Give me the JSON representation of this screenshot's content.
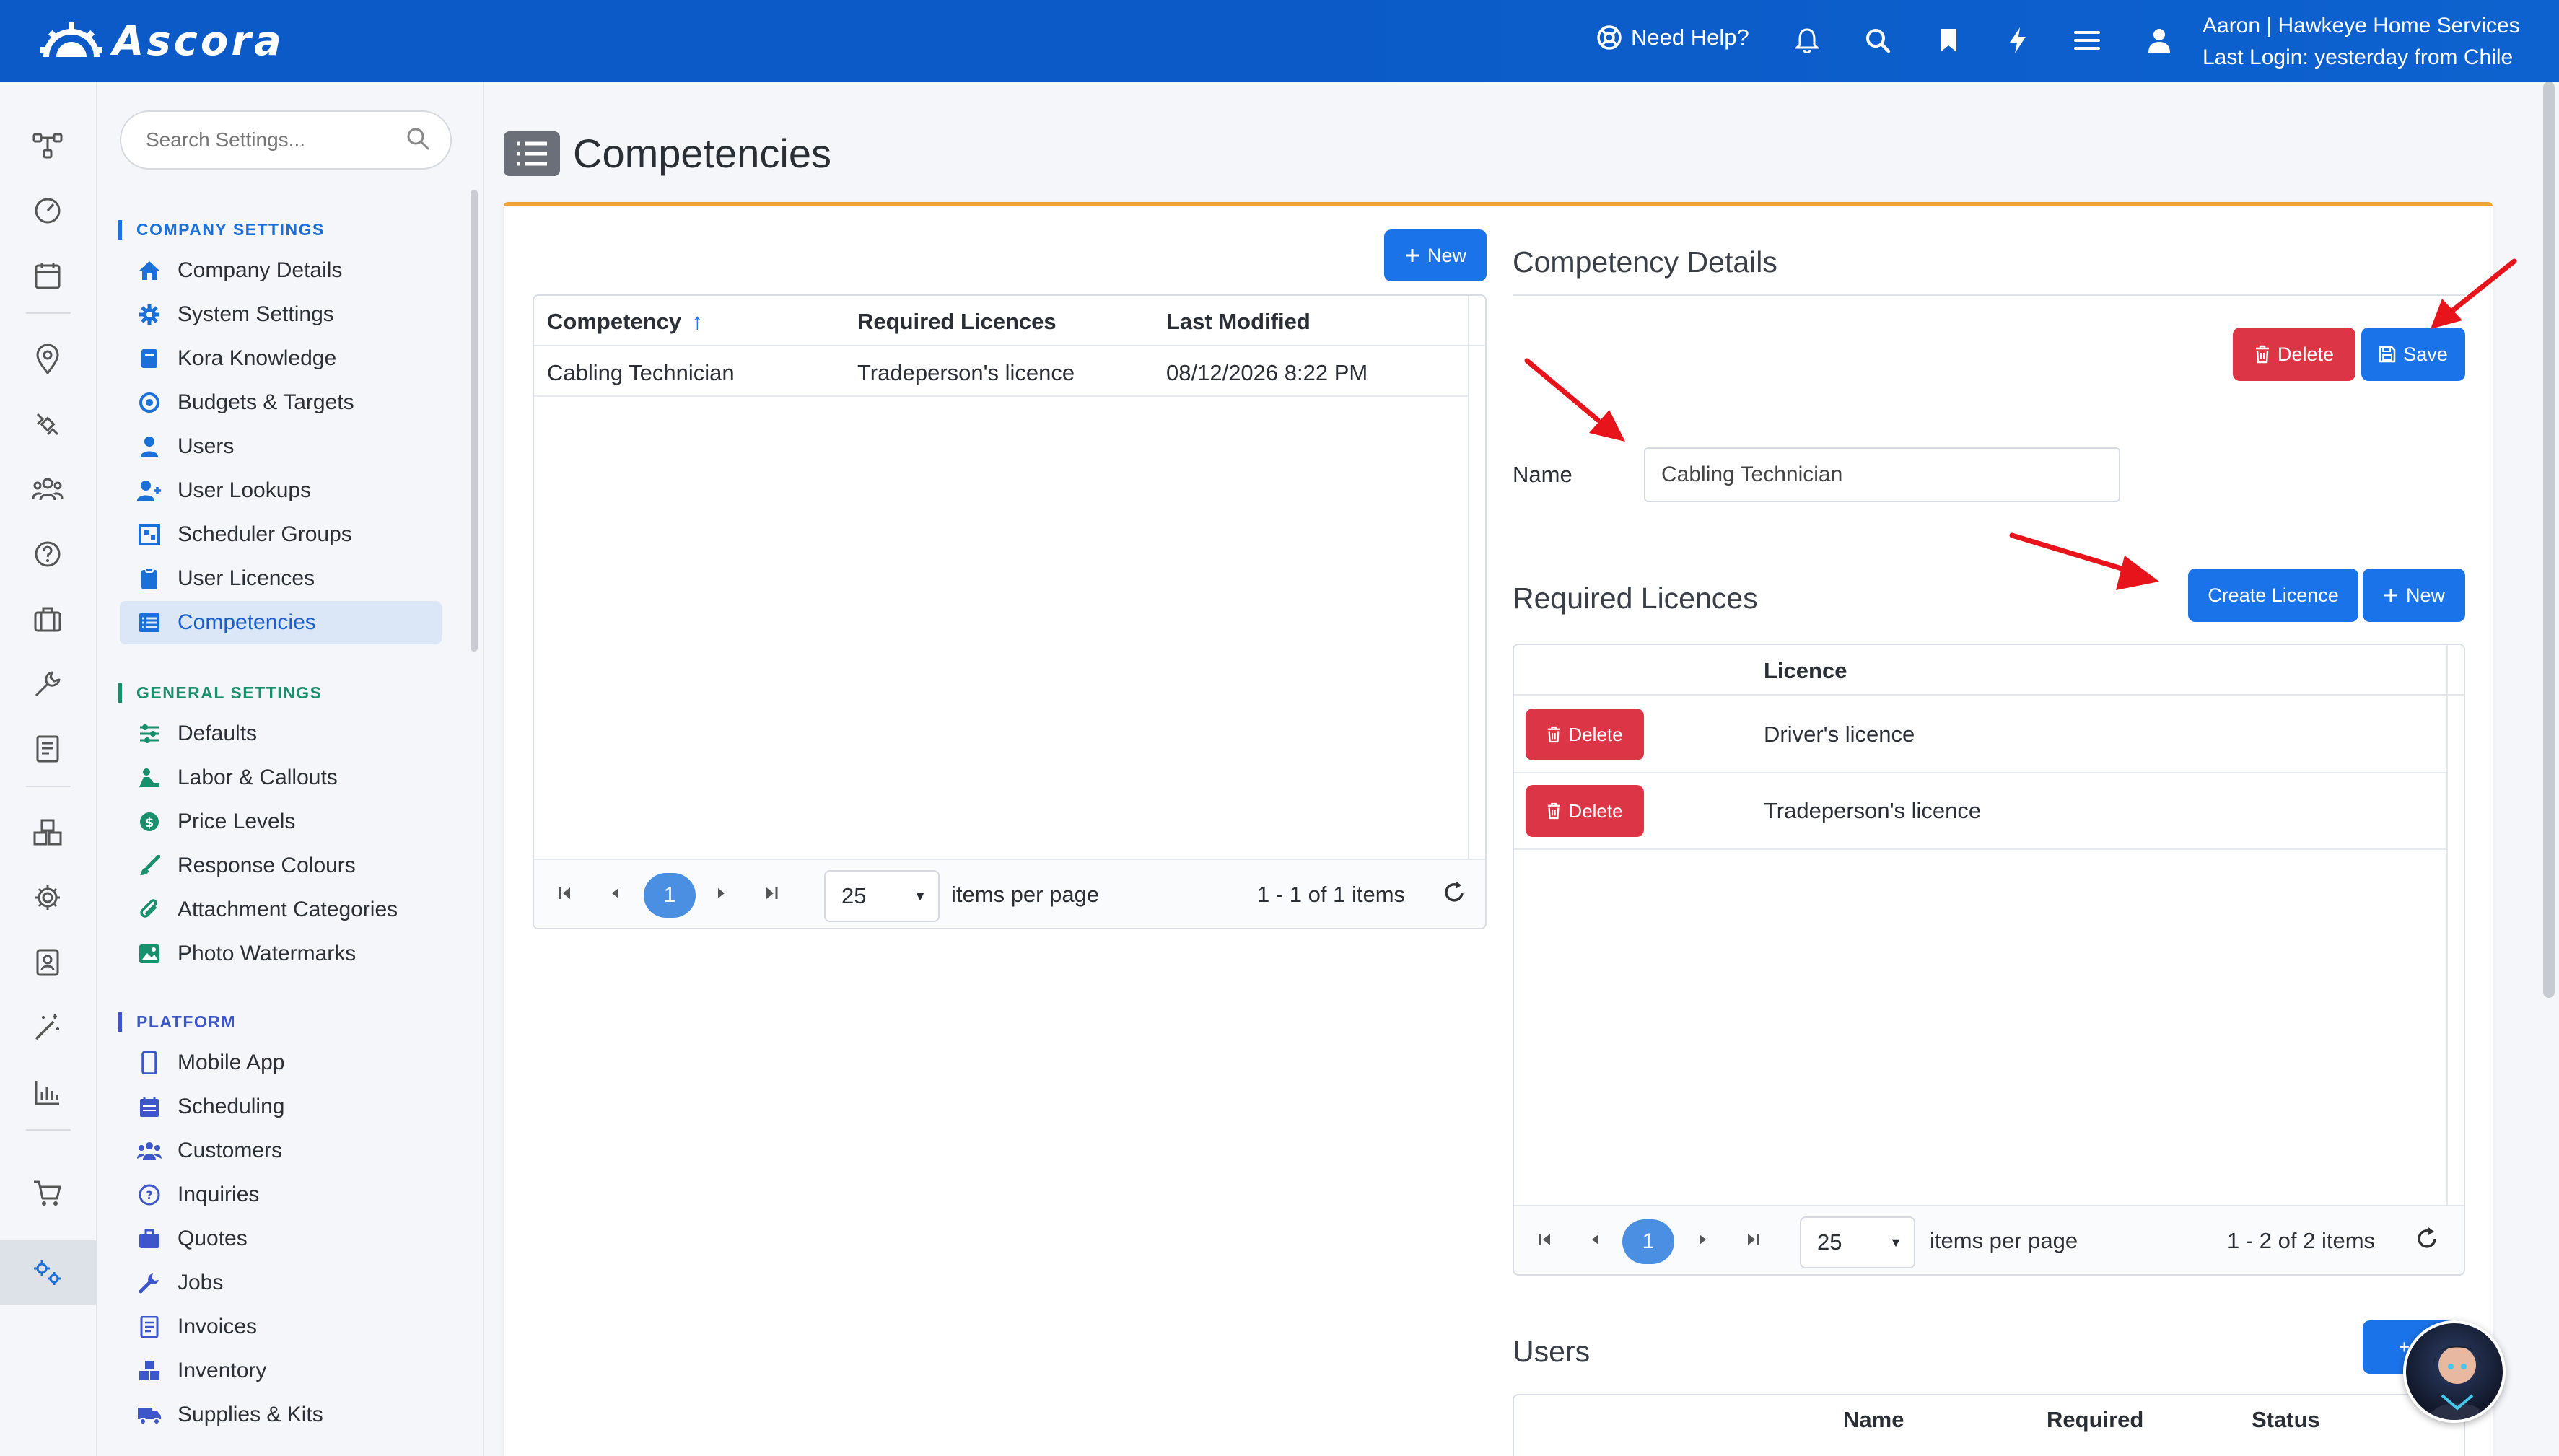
{
  "app": {
    "brand": "Ascora",
    "help_label": "Need Help?",
    "user_name": "Aaron | Hawkeye Home Services",
    "last_login": "Last Login: yesterday from Chile"
  },
  "sidebar": {
    "search_placeholder": "Search Settings...",
    "sections": {
      "company": "COMPANY SETTINGS",
      "general": "GENERAL SETTINGS",
      "platform": "PLATFORM"
    },
    "company_items": [
      "Company Details",
      "System Settings",
      "Kora Knowledge",
      "Budgets & Targets",
      "Users",
      "User Lookups",
      "Scheduler Groups",
      "User Licences",
      "Competencies"
    ],
    "general_items": [
      "Defaults",
      "Labor & Callouts",
      "Price Levels",
      "Response Colours",
      "Attachment Categories",
      "Photo Watermarks"
    ],
    "platform_items": [
      "Mobile App",
      "Scheduling",
      "Customers",
      "Inquiries",
      "Quotes",
      "Jobs",
      "Invoices",
      "Inventory",
      "Supplies & Kits"
    ],
    "active_item": "Competencies"
  },
  "page": {
    "title": "Competencies"
  },
  "competencies_grid": {
    "new_label": "New",
    "columns": [
      "Competency",
      "Required Licences",
      "Last Modified"
    ],
    "rows": [
      [
        "Cabling Technician",
        "Tradeperson's licence",
        "08/12/2026 8:22 PM"
      ]
    ],
    "pager": {
      "page": "1",
      "page_size": "25",
      "items_per_page": "items per page",
      "summary": "1 - 1 of 1 items"
    }
  },
  "details": {
    "title": "Competency Details",
    "delete_label": "Delete",
    "save_label": "Save",
    "name_label": "Name",
    "name_value": "Cabling Technician",
    "required_title": "Required Licences",
    "create_licence_label": "Create Licence",
    "new_label": "New",
    "licence_column": "Licence",
    "licence_rows": [
      {
        "delete": "Delete",
        "licence": "Driver's licence"
      },
      {
        "delete": "Delete",
        "licence": "Tradeperson's licence"
      }
    ],
    "pager": {
      "page": "1",
      "page_size": "25",
      "items_per_page": "items per page",
      "summary": "1 - 2 of 2 items"
    },
    "users_title": "Users",
    "users_new_label": "+ N",
    "users_columns": [
      "Name",
      "Required",
      "Status"
    ]
  },
  "colors": {
    "topbar": "#0b5ac8",
    "primary": "#1a73e8",
    "danger": "#dc3545",
    "accent_rule": "#f0a532",
    "annotation_arrow": "#e8141c"
  }
}
